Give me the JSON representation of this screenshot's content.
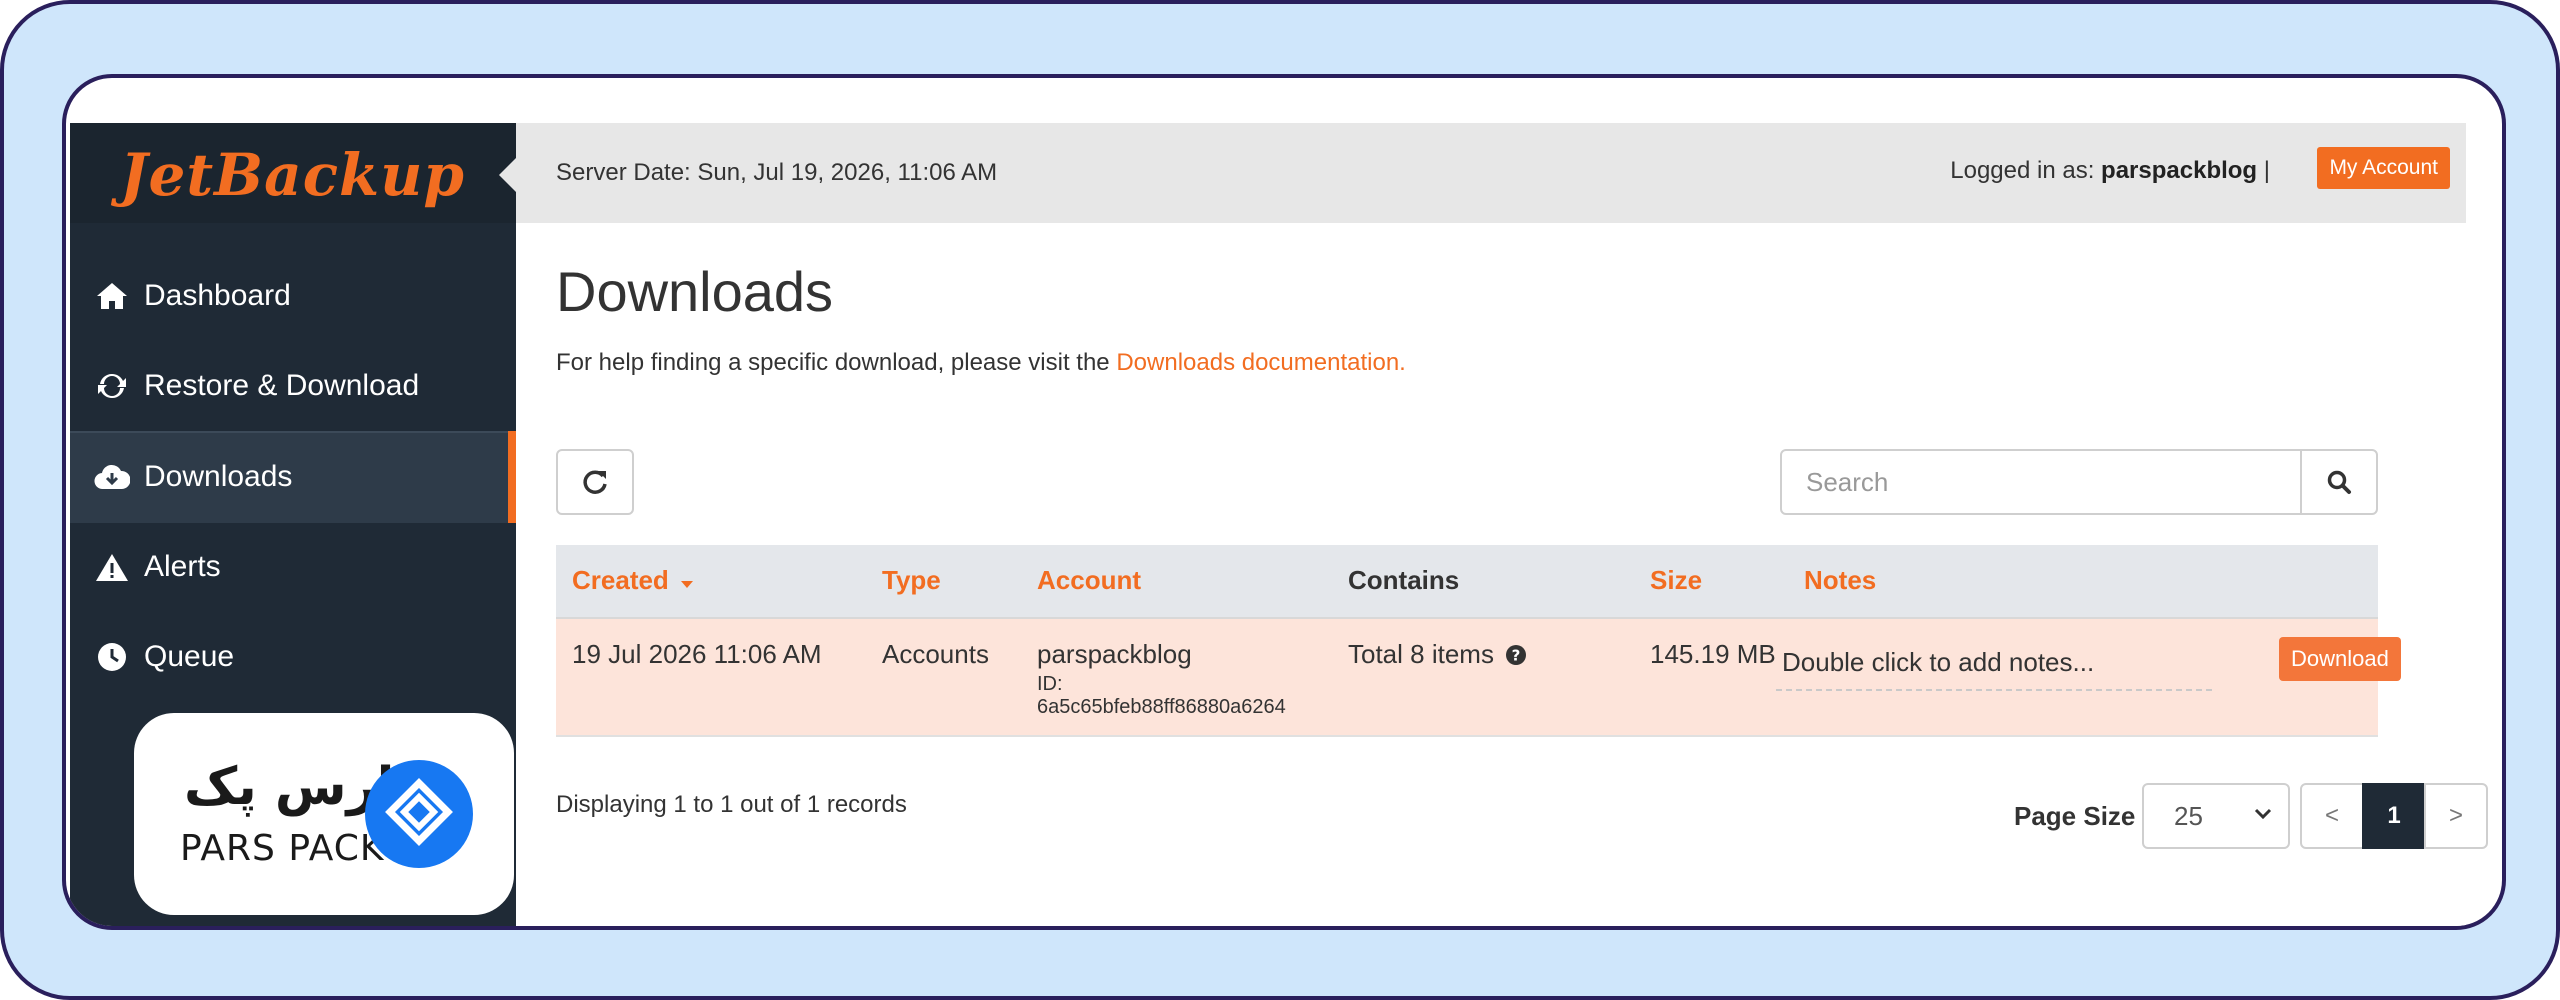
{
  "brand": {
    "logo_text": "JetBackup"
  },
  "sidebar": {
    "items": [
      {
        "label": "Dashboard",
        "icon": "home-icon"
      },
      {
        "label": "Restore & Download",
        "icon": "refresh-icon"
      },
      {
        "label": "Downloads",
        "icon": "cloud-download-icon",
        "active": true
      },
      {
        "label": "Alerts",
        "icon": "warning-icon"
      },
      {
        "label": "Queue",
        "icon": "clock-icon"
      }
    ]
  },
  "overlay": {
    "fa_text": "پارس پک",
    "en_text": "PARS PACK"
  },
  "topbar": {
    "server_date": "Server Date: Sun, Jul 19, 2026, 11:06 AM",
    "logged_in_prefix": "Logged in as:",
    "username": "parspackblog",
    "separator": "|",
    "my_account_label": "My Account"
  },
  "page": {
    "title": "Downloads",
    "help_text": "For help finding a specific download, please visit the",
    "help_link": "Downloads documentation."
  },
  "search": {
    "placeholder": "Search"
  },
  "table": {
    "headers": {
      "created": "Created",
      "type": "Type",
      "account": "Account",
      "contains": "Contains",
      "size": "Size",
      "notes": "Notes"
    },
    "rows": [
      {
        "created": "19 Jul 2026 11:06 AM",
        "type": "Accounts",
        "account": "parspackblog",
        "account_id_label": "ID:",
        "account_id": "6a5c65bfeb88ff86880a6264",
        "contains": "Total 8 items",
        "size": "145.19 MB",
        "notes": "Double click to add notes...",
        "action": "Download"
      }
    ]
  },
  "footer": {
    "records": "Displaying 1 to 1 out of 1 records",
    "page_size_label": "Page Size",
    "page_size_value": "25",
    "pager": {
      "prev": "<",
      "current": "1",
      "next": ">"
    }
  },
  "colors": {
    "accent": "#f26d21",
    "sidebar_bg": "#1f2a36",
    "row_highlight": "#fde4da",
    "frame_bg": "#cfe6fb",
    "frame_border": "#2a1f5c"
  }
}
